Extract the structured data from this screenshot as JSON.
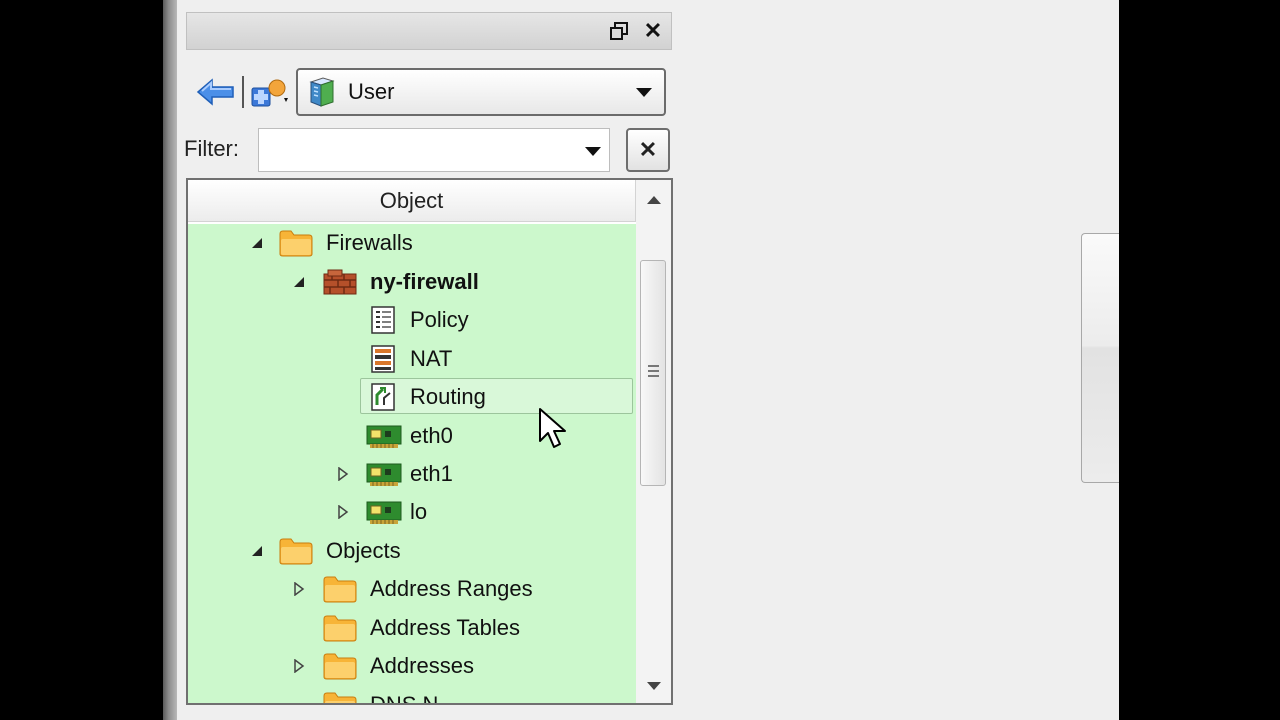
{
  "panel": {
    "float_icon": "restore-window-icon",
    "close_glyph": "✕"
  },
  "toolbar": {
    "back_icon": "back-arrow-icon",
    "new_object_icon": "new-object-icon",
    "library": {
      "selected": "User",
      "icon": "library-book-icon"
    }
  },
  "filter": {
    "label": "Filter:",
    "value": "",
    "placeholder": "",
    "clear_glyph": "✕"
  },
  "tree": {
    "header": "Object",
    "rows": [
      {
        "label": "Firewalls",
        "icon": "folder-icon",
        "expander": "expanded",
        "bold": false
      },
      {
        "label": "ny-firewall",
        "icon": "firewall-icon",
        "expander": "expanded",
        "bold": true
      },
      {
        "label": "Policy",
        "icon": "policy-icon",
        "expander": "none",
        "bold": false
      },
      {
        "label": "NAT",
        "icon": "nat-icon",
        "expander": "none",
        "bold": false
      },
      {
        "label": "Routing",
        "icon": "routing-icon",
        "expander": "none",
        "bold": false,
        "hover": true
      },
      {
        "label": "eth0",
        "icon": "network-interface-icon",
        "expander": "none",
        "bold": false
      },
      {
        "label": "eth1",
        "icon": "network-interface-icon",
        "expander": "collapsed",
        "bold": false
      },
      {
        "label": "lo",
        "icon": "network-interface-icon",
        "expander": "collapsed",
        "bold": false
      },
      {
        "label": "Objects",
        "icon": "folder-icon",
        "expander": "expanded",
        "bold": false
      },
      {
        "label": "Address Ranges",
        "icon": "folder-icon",
        "expander": "collapsed",
        "bold": false
      },
      {
        "label": "Address Tables",
        "icon": "folder-icon",
        "expander": "none",
        "bold": false
      },
      {
        "label": "Addresses",
        "icon": "folder-icon",
        "expander": "collapsed",
        "bold": false
      },
      {
        "label": "DNS N",
        "icon": "folder-icon",
        "expander": "none",
        "bold": false
      }
    ]
  },
  "colors": {
    "tree_background": "#ccf8cc",
    "folder": "#f5a623",
    "firewall": "#b5502a",
    "interface": "#2e8b2e"
  }
}
